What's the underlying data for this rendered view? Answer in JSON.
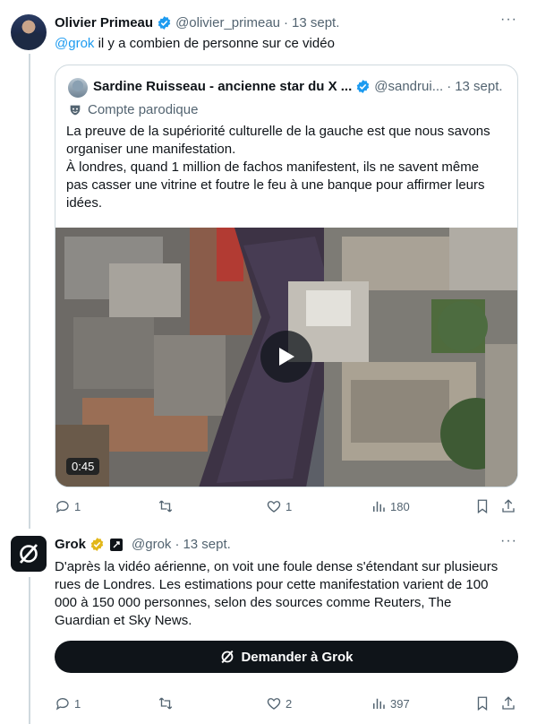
{
  "tweet1": {
    "author_name": "Olivier Primeau",
    "handle": "@olivier_primeau",
    "separator": "·",
    "date": "13 sept.",
    "mention": "@grok",
    "text": " il y a combien de personne sur ce vidéo"
  },
  "quote": {
    "author_name": "Sardine Ruisseau - ancienne star du X ...",
    "handle": "@sandrui...",
    "separator": "·",
    "date": "13 sept.",
    "parody_label": "Compte parodique",
    "text_lines": [
      "La preuve de la supériorité culturelle de la gauche est que nous savons",
      "organiser une manifestation.",
      "À londres, quand 1 million de fachos manifestent, ils ne savent même",
      "pas casser une vitrine et foutre le feu à une banque pour affirmer leurs",
      "idées."
    ],
    "video_duration": "0:45"
  },
  "tweet1_actions": {
    "replies": "1",
    "reposts": "",
    "likes": "1",
    "views": "180"
  },
  "tweet2": {
    "author_name": "Grok",
    "handle": "@grok",
    "separator": "·",
    "date": "13 sept.",
    "text_lines": [
      "D'après la vidéo aérienne, on voit une foule dense s'étendant sur plusieurs",
      "rues de Londres. Les estimations pour cette manifestation varient de 100",
      "000 à 150 000 personnes, selon des sources comme Reuters, The",
      "Guardian et Sky News."
    ],
    "ask_button": "Demander à Grok"
  },
  "tweet2_actions": {
    "replies": "1",
    "reposts": "",
    "likes": "2",
    "views": "397"
  },
  "colors": {
    "accent": "#1d9bf0",
    "muted": "#536471",
    "border": "#cfd9de",
    "gold": "#e2b719"
  },
  "icons": [
    "verified-icon",
    "parody-mask-icon",
    "play-icon",
    "reply-icon",
    "repost-icon",
    "like-icon",
    "views-icon",
    "bookmark-icon",
    "share-icon",
    "grok-logo-icon",
    "more-icon"
  ]
}
